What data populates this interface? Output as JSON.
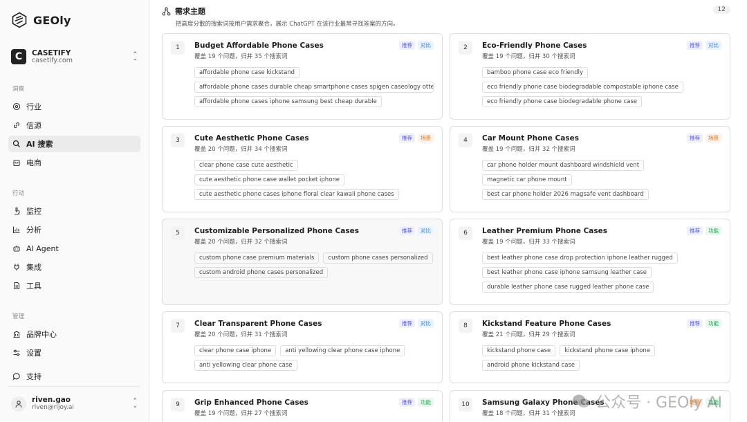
{
  "app": {
    "name": "GEOly"
  },
  "brand": {
    "name": "CASETIFY",
    "domain": "casetify.com",
    "avatar_letter": "C"
  },
  "sections": {
    "insight": "洞察",
    "action": "行动",
    "manage": "管理"
  },
  "nav": {
    "industry": "行业",
    "sources": "信源",
    "ai_search": "AI 搜索",
    "ecommerce": "电商",
    "monitor": "监控",
    "analysis": "分析",
    "ai_agent": "AI Agent",
    "integration": "集成",
    "tools": "工具",
    "brand_center": "品牌中心",
    "settings": "设置",
    "support": "支持"
  },
  "user": {
    "name": "riven.gao",
    "email": "riven@rijoy.ai"
  },
  "panel": {
    "title": "需求主题",
    "subtitle": "把高度分散的搜索词按用户需求聚合，展示 ChatGPT 在该行业最常寻找答案的方向。",
    "count": "12"
  },
  "cards": [
    {
      "num": "1",
      "title": "Budget Affordable Phone Cases",
      "meta": "覆盖 19 个问题，归并 35 个搜索词",
      "tags": [
        "推荐",
        "对比"
      ],
      "keywords": [
        "affordable phone case kickstand",
        "affordable phone cases durable cheap smartphone cases spigen caseology otterbox",
        "affordable phone cases iphone samsung best cheap durable"
      ]
    },
    {
      "num": "2",
      "title": "Eco-Friendly Phone Cases",
      "meta": "覆盖 19 个问题，归并 30 个搜索词",
      "tags": [
        "推荐",
        "对比"
      ],
      "keywords": [
        "bamboo phone case eco friendly",
        "eco friendly phone case biodegradable compostable iphone case",
        "eco friendly phone case biodegradable phone case"
      ]
    },
    {
      "num": "3",
      "title": "Cute Aesthetic Phone Cases",
      "meta": "覆盖 20 个问题，归并 34 个搜索词",
      "tags": [
        "推荐",
        "场景"
      ],
      "keywords": [
        "clear phone case cute aesthetic",
        "cute aesthetic phone case wallet pocket iphone",
        "cute aesthetic phone cases iphone floral clear kawaii phone cases"
      ]
    },
    {
      "num": "4",
      "title": "Car Mount Phone Cases",
      "meta": "覆盖 19 个问题，归并 32 个搜索词",
      "tags": [
        "推荐",
        "场景"
      ],
      "keywords": [
        "car phone holder mount dashboard windshield vent",
        "magnetic car phone mount",
        "best car phone holder 2026 magsafe vent dashboard"
      ]
    },
    {
      "num": "5",
      "title": "Customizable Personalized Phone Cases",
      "meta": "覆盖 20 个问题，归并 32 个搜索词",
      "tags": [
        "推荐",
        "对比"
      ],
      "keywords": [
        "custom phone case premium materials",
        "custom phone cases personalized",
        "custom android phone cases personalized"
      ]
    },
    {
      "num": "6",
      "title": "Leather Premium Phone Cases",
      "meta": "覆盖 19 个问题，归并 33 个搜索词",
      "tags": [
        "推荐",
        "功能"
      ],
      "keywords": [
        "best leather phone case drop protection iphone leather rugged",
        "best leather phone case iphone samsung leather case",
        "durable leather phone case rugged leather phone case"
      ]
    },
    {
      "num": "7",
      "title": "Clear Transparent Phone Cases",
      "meta": "覆盖 20 个问题，归并 31 个搜索词",
      "tags": [
        "推荐",
        "对比"
      ],
      "keywords": [
        "clear phone case iphone",
        "anti yellowing clear phone case iphone",
        "anti yellowing clear phone case"
      ]
    },
    {
      "num": "8",
      "title": "Kickstand Feature Phone Cases",
      "meta": "覆盖 21 个问题，归并 29 个搜索词",
      "tags": [
        "推荐",
        "功能"
      ],
      "keywords": [
        "kickstand phone case",
        "kickstand phone case iphone",
        "android phone kickstand case"
      ]
    },
    {
      "num": "9",
      "title": "Grip Enhanced Phone Cases",
      "meta": "覆盖 19 个问题，归并 27 个搜索词",
      "tags": [
        "推荐",
        "功能"
      ],
      "keywords": []
    },
    {
      "num": "10",
      "title": "Samsung Galaxy Phone Cases",
      "meta": "覆盖 18 个问题，归并 31 个搜索词",
      "tags": [
        "场景",
        "功能"
      ],
      "keywords": []
    }
  ],
  "tag_colors": {
    "推荐": "t-rec",
    "对比": "t-cmp",
    "场景": "t-scn",
    "功能": "t-fn"
  },
  "watermark": "公众号 · GEOly AI"
}
